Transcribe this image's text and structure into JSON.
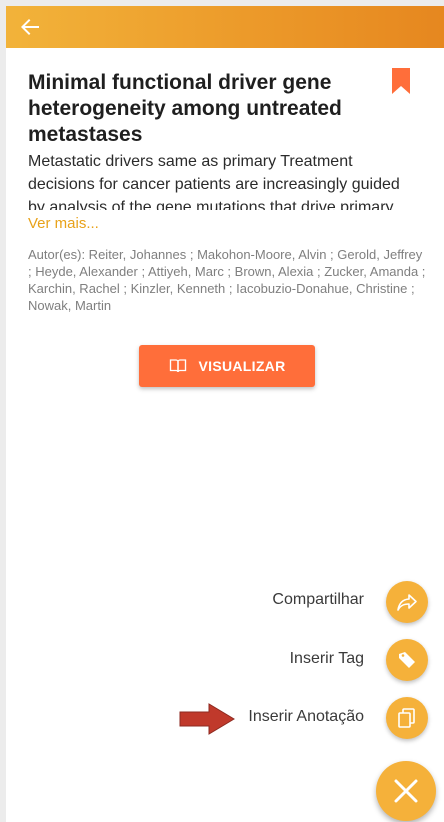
{
  "toolbar": {
    "back_icon": "arrow-left-icon",
    "color": "#ec9a2a"
  },
  "article": {
    "title": "Minimal functional driver gene heterogeneity among untreated metastases",
    "bookmark_icon": "bookmark-icon",
    "summary": "Metastatic drivers same as primary Treatment decisions for cancer patients are increasingly guided by analysis of the gene mutations that drive primary",
    "see_more": "Ver mais...",
    "authors": "Autor(es): Reiter, Johannes ; Makohon-Moore, Alvin ; Gerold, Jeffrey ; Heyde, Alexander ; Attiyeh, Marc ; Brown, Alexia ; Zucker, Amanda ; Karchin, Rachel ; Kinzler, Kenneth ; Iacobuzio-Donahue, Christine ; Nowak, Martin",
    "view_button": "VISUALIZAR",
    "view_icon": "book-open-icon",
    "accent": "#ff6e3a"
  },
  "fab_menu": {
    "items": [
      {
        "label": "Compartilhar",
        "icon": "share-icon"
      },
      {
        "label": "Inserir Tag",
        "icon": "tag-icon"
      },
      {
        "label": "Inserir Anotação",
        "icon": "copy-icon"
      }
    ],
    "close_icon": "close-icon",
    "color": "#f5b13a"
  },
  "annotation_arrow_color": "#c0392b"
}
